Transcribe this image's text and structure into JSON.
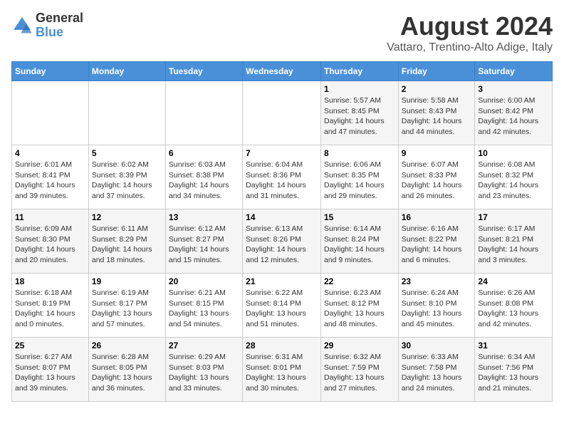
{
  "header": {
    "logo_general": "General",
    "logo_blue": "Blue",
    "title": "August 2024",
    "subtitle": "Vattaro, Trentino-Alto Adige, Italy"
  },
  "columns": [
    "Sunday",
    "Monday",
    "Tuesday",
    "Wednesday",
    "Thursday",
    "Friday",
    "Saturday"
  ],
  "weeks": [
    [
      {
        "day": "",
        "detail": ""
      },
      {
        "day": "",
        "detail": ""
      },
      {
        "day": "",
        "detail": ""
      },
      {
        "day": "",
        "detail": ""
      },
      {
        "day": "1",
        "detail": "Sunrise: 5:57 AM\nSunset: 8:45 PM\nDaylight: 14 hours and 47 minutes."
      },
      {
        "day": "2",
        "detail": "Sunrise: 5:58 AM\nSunset: 8:43 PM\nDaylight: 14 hours and 44 minutes."
      },
      {
        "day": "3",
        "detail": "Sunrise: 6:00 AM\nSunset: 8:42 PM\nDaylight: 14 hours and 42 minutes."
      }
    ],
    [
      {
        "day": "4",
        "detail": "Sunrise: 6:01 AM\nSunset: 8:41 PM\nDaylight: 14 hours and 39 minutes."
      },
      {
        "day": "5",
        "detail": "Sunrise: 6:02 AM\nSunset: 8:39 PM\nDaylight: 14 hours and 37 minutes."
      },
      {
        "day": "6",
        "detail": "Sunrise: 6:03 AM\nSunset: 8:38 PM\nDaylight: 14 hours and 34 minutes."
      },
      {
        "day": "7",
        "detail": "Sunrise: 6:04 AM\nSunset: 8:36 PM\nDaylight: 14 hours and 31 minutes."
      },
      {
        "day": "8",
        "detail": "Sunrise: 6:06 AM\nSunset: 8:35 PM\nDaylight: 14 hours and 29 minutes."
      },
      {
        "day": "9",
        "detail": "Sunrise: 6:07 AM\nSunset: 8:33 PM\nDaylight: 14 hours and 26 minutes."
      },
      {
        "day": "10",
        "detail": "Sunrise: 6:08 AM\nSunset: 8:32 PM\nDaylight: 14 hours and 23 minutes."
      }
    ],
    [
      {
        "day": "11",
        "detail": "Sunrise: 6:09 AM\nSunset: 8:30 PM\nDaylight: 14 hours and 20 minutes."
      },
      {
        "day": "12",
        "detail": "Sunrise: 6:11 AM\nSunset: 8:29 PM\nDaylight: 14 hours and 18 minutes."
      },
      {
        "day": "13",
        "detail": "Sunrise: 6:12 AM\nSunset: 8:27 PM\nDaylight: 14 hours and 15 minutes."
      },
      {
        "day": "14",
        "detail": "Sunrise: 6:13 AM\nSunset: 8:26 PM\nDaylight: 14 hours and 12 minutes."
      },
      {
        "day": "15",
        "detail": "Sunrise: 6:14 AM\nSunset: 8:24 PM\nDaylight: 14 hours and 9 minutes."
      },
      {
        "day": "16",
        "detail": "Sunrise: 6:16 AM\nSunset: 8:22 PM\nDaylight: 14 hours and 6 minutes."
      },
      {
        "day": "17",
        "detail": "Sunrise: 6:17 AM\nSunset: 8:21 PM\nDaylight: 14 hours and 3 minutes."
      }
    ],
    [
      {
        "day": "18",
        "detail": "Sunrise: 6:18 AM\nSunset: 8:19 PM\nDaylight: 14 hours and 0 minutes."
      },
      {
        "day": "19",
        "detail": "Sunrise: 6:19 AM\nSunset: 8:17 PM\nDaylight: 13 hours and 57 minutes."
      },
      {
        "day": "20",
        "detail": "Sunrise: 6:21 AM\nSunset: 8:15 PM\nDaylight: 13 hours and 54 minutes."
      },
      {
        "day": "21",
        "detail": "Sunrise: 6:22 AM\nSunset: 8:14 PM\nDaylight: 13 hours and 51 minutes."
      },
      {
        "day": "22",
        "detail": "Sunrise: 6:23 AM\nSunset: 8:12 PM\nDaylight: 13 hours and 48 minutes."
      },
      {
        "day": "23",
        "detail": "Sunrise: 6:24 AM\nSunset: 8:10 PM\nDaylight: 13 hours and 45 minutes."
      },
      {
        "day": "24",
        "detail": "Sunrise: 6:26 AM\nSunset: 8:08 PM\nDaylight: 13 hours and 42 minutes."
      }
    ],
    [
      {
        "day": "25",
        "detail": "Sunrise: 6:27 AM\nSunset: 8:07 PM\nDaylight: 13 hours and 39 minutes."
      },
      {
        "day": "26",
        "detail": "Sunrise: 6:28 AM\nSunset: 8:05 PM\nDaylight: 13 hours and 36 minutes."
      },
      {
        "day": "27",
        "detail": "Sunrise: 6:29 AM\nSunset: 8:03 PM\nDaylight: 13 hours and 33 minutes."
      },
      {
        "day": "28",
        "detail": "Sunrise: 6:31 AM\nSunset: 8:01 PM\nDaylight: 13 hours and 30 minutes."
      },
      {
        "day": "29",
        "detail": "Sunrise: 6:32 AM\nSunset: 7:59 PM\nDaylight: 13 hours and 27 minutes."
      },
      {
        "day": "30",
        "detail": "Sunrise: 6:33 AM\nSunset: 7:58 PM\nDaylight: 13 hours and 24 minutes."
      },
      {
        "day": "31",
        "detail": "Sunrise: 6:34 AM\nSunset: 7:56 PM\nDaylight: 13 hours and 21 minutes."
      }
    ]
  ]
}
